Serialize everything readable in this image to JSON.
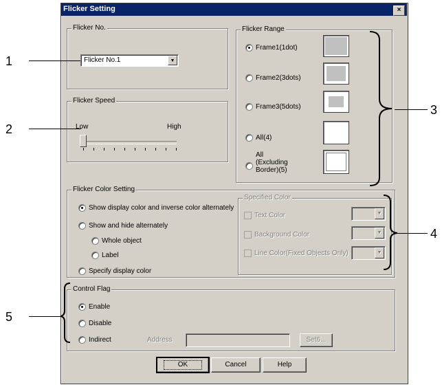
{
  "window": {
    "title": "Flicker Setting",
    "close_glyph": "×"
  },
  "flicker_no": {
    "group_label": "Flicker No.",
    "selected": "Flicker No.1"
  },
  "flicker_speed": {
    "group_label": "Flicker Speed",
    "low_label": "Low",
    "high_label": "High",
    "level": 0
  },
  "flicker_range": {
    "group_label": "Flicker Range",
    "options": [
      {
        "label": "Frame1(1dot)",
        "checked": true
      },
      {
        "label": "Frame2(3dots)",
        "checked": false
      },
      {
        "label": "Frame3(5dots)",
        "checked": false
      },
      {
        "label": "All(4)",
        "checked": false
      },
      {
        "label_line1": "All",
        "label_line2": "(Excluding",
        "label_line3": "Border)(5)",
        "checked": false
      }
    ]
  },
  "color_setting": {
    "group_label": "Flicker Color Setting",
    "options": [
      {
        "label": "Show display color and inverse color alternately",
        "checked": true
      },
      {
        "label": "Show and hide alternately",
        "checked": false
      },
      {
        "label": "Whole object",
        "checked": false
      },
      {
        "label": "Label",
        "checked": false
      },
      {
        "label": "Specify display color",
        "checked": false
      }
    ],
    "specified": {
      "group_label": "Specified Color",
      "items": [
        "Text Color",
        "Background Color",
        "Line Color(Fixed Objects Only)"
      ]
    }
  },
  "control_flag": {
    "group_label": "Control Flag",
    "options": [
      {
        "label": "Enable",
        "checked": true
      },
      {
        "label": "Disable",
        "checked": false
      },
      {
        "label": "Indirect",
        "checked": false
      }
    ],
    "address_label": "Address",
    "address_value": "",
    "set_button": "Set6..."
  },
  "buttons": {
    "ok": "OK",
    "cancel": "Cancel",
    "help": "Help"
  },
  "callouts": [
    "1",
    "2",
    "3",
    "4",
    "5"
  ]
}
